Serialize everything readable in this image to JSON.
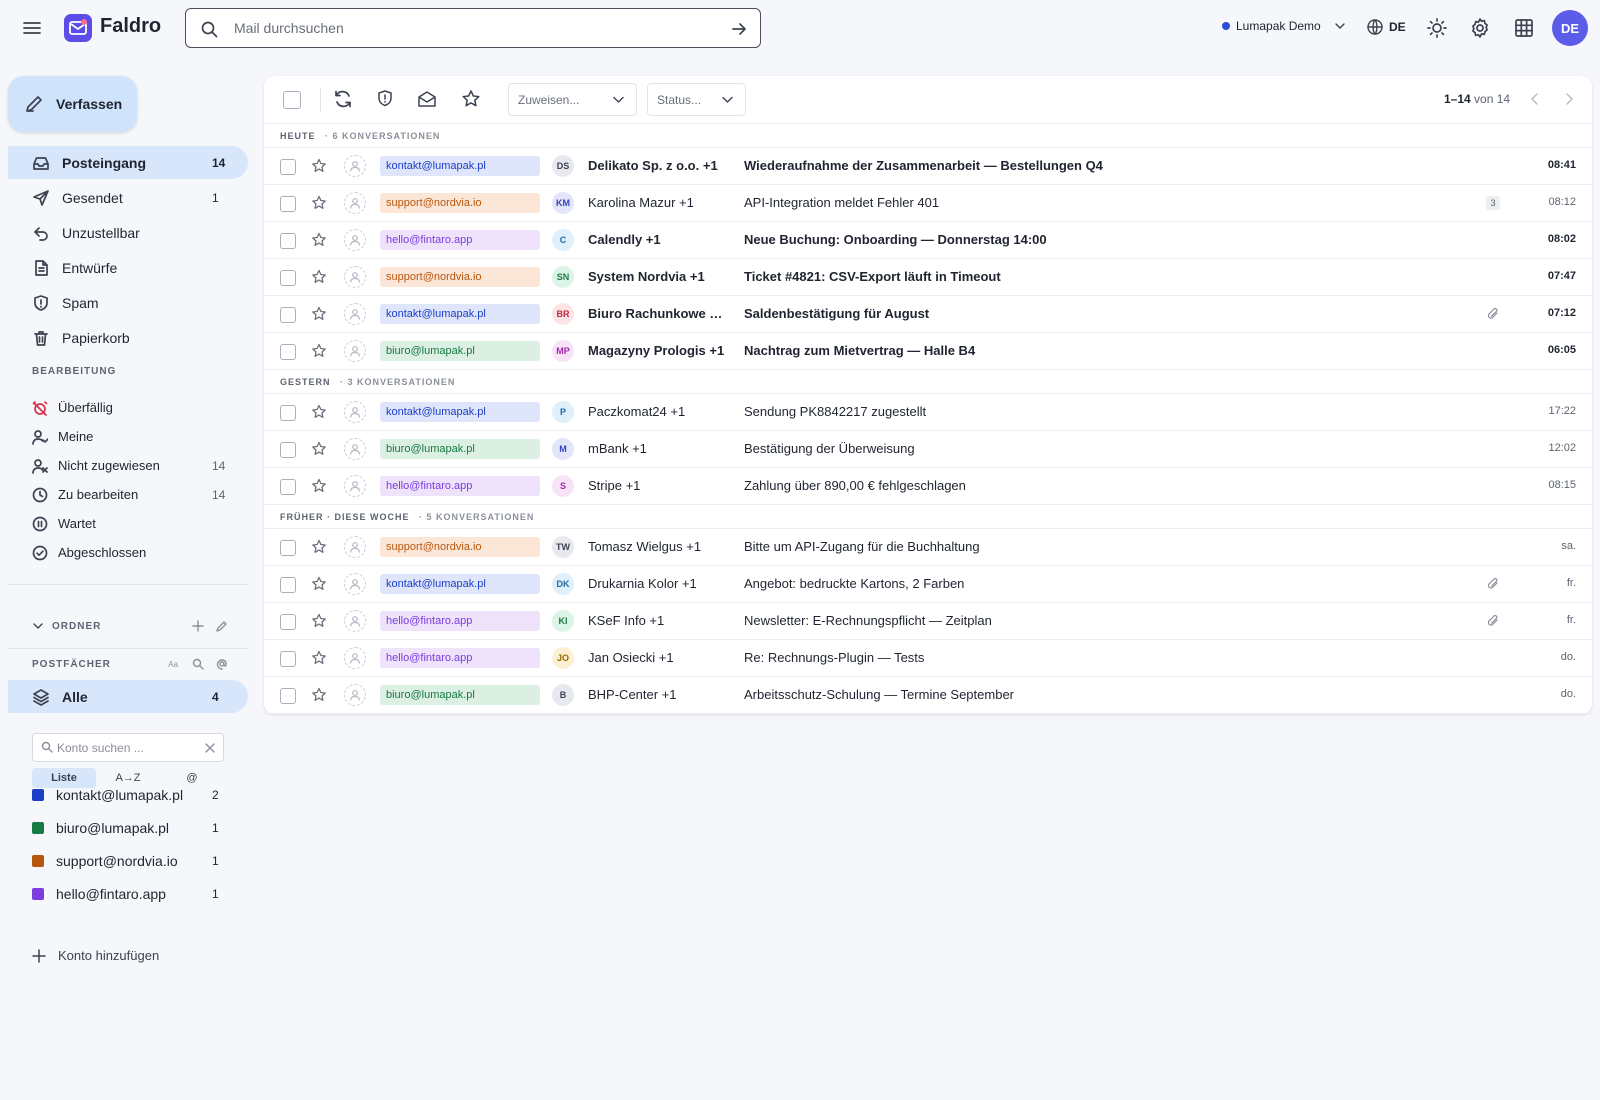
{
  "app": {
    "name": "Faldro"
  },
  "search": {
    "placeholder": "Mail durchsuchen"
  },
  "topbar": {
    "account": "Lumapak Demo",
    "lang": "DE",
    "user_initials": "DE"
  },
  "sidebar": {
    "compose": "Verfassen",
    "folders": [
      {
        "label": "Posteingang",
        "count": "14",
        "icon": "inbox-icon"
      },
      {
        "label": "Gesendet",
        "count": "1",
        "icon": "send-icon"
      },
      {
        "label": "Unzustellbar",
        "count": "",
        "icon": "bounce-icon"
      },
      {
        "label": "Entwürfe",
        "count": "",
        "icon": "draft-icon"
      },
      {
        "label": "Spam",
        "count": "",
        "icon": "spam-shield-icon"
      },
      {
        "label": "Papierkorb",
        "count": "",
        "icon": "trash-icon"
      }
    ],
    "workflow_title": "BEARBEITUNG",
    "workflow": [
      {
        "label": "Überfällig",
        "count": "",
        "icon": "alarm-off-icon"
      },
      {
        "label": "Meine",
        "count": "",
        "icon": "user-check-icon"
      },
      {
        "label": "Nicht zugewiesen",
        "count": "14",
        "icon": "user-x-icon"
      },
      {
        "label": "Zu bearbeiten",
        "count": "14",
        "icon": "clock-icon"
      },
      {
        "label": "Wartet",
        "count": "",
        "icon": "pause-icon"
      },
      {
        "label": "Abgeschlossen",
        "count": "",
        "icon": "check-circle-icon"
      }
    ],
    "ordner_title": "ORDNER",
    "postfaecher_title": "POSTFÄCHER",
    "all": {
      "label": "Alle",
      "count": "4"
    },
    "account_search_placeholder": "Konto suchen ...",
    "view_toggle": [
      "Liste",
      "A→Z",
      "@"
    ],
    "accounts": [
      {
        "label": "kontakt@lumapak.pl",
        "count": "2",
        "color": "#1d3fc6"
      },
      {
        "label": "biuro@lumapak.pl",
        "count": "1",
        "color": "#177a43"
      },
      {
        "label": "support@nordvia.io",
        "count": "1",
        "color": "#b8560e"
      },
      {
        "label": "hello@fintaro.app",
        "count": "1",
        "color": "#7b3ce0"
      }
    ],
    "add_account": "Konto hinzufügen"
  },
  "toolbar": {
    "assign_placeholder": "Zuweisen...",
    "status_placeholder": "Status...",
    "pager_range": "1–14",
    "pager_total": "von 14"
  },
  "groups": [
    {
      "title": "HEUTE",
      "count": "6 KONVERSATIONEN"
    },
    {
      "title": "GESTERN",
      "count": "3 KONVERSATIONEN"
    },
    {
      "title": "FRÜHER · DIESE WOCHE",
      "count": "5 KONVERSATIONEN"
    }
  ],
  "mailbox_colors": {
    "kontakt@lumapak.pl": {
      "bg": "#dfe5fb",
      "fg": "#1d3fc6"
    },
    "support@nordvia.io": {
      "bg": "#fbe6d7",
      "fg": "#b8560e"
    },
    "hello@fintaro.app": {
      "bg": "#efe3fc",
      "fg": "#7b3ce0"
    },
    "biuro@lumapak.pl": {
      "bg": "#dcefe3",
      "fg": "#177a43"
    }
  },
  "emails": [
    {
      "mailbox": "kontakt@lumapak.pl",
      "initials": "DS",
      "sender": "Delikato Sp. z o.o. +1",
      "subject": "Wiederaufnahme der Zusammenarbeit — Bestellungen Q4",
      "time": "08:41",
      "unread": true,
      "thread": "",
      "attachment": false,
      "av_bg": "#e7e9ee",
      "av_fg": "#3c4250"
    },
    {
      "mailbox": "support@nordvia.io",
      "initials": "KM",
      "sender": "Karolina Mazur +1",
      "subject": "API-Integration meldet Fehler 401",
      "time": "08:12",
      "unread": false,
      "thread": "3",
      "attachment": false,
      "av_bg": "#e3e6fb",
      "av_fg": "#3a43b8"
    },
    {
      "mailbox": "hello@fintaro.app",
      "initials": "C",
      "sender": "Calendly +1",
      "subject": "Neue Buchung: Onboarding — Donnerstag 14:00",
      "time": "08:02",
      "unread": true,
      "thread": "",
      "attachment": false,
      "av_bg": "#dff0fb",
      "av_fg": "#1f6aa6"
    },
    {
      "mailbox": "support@nordvia.io",
      "initials": "SN",
      "sender": "System Nordvia +1",
      "subject": "Ticket #4821: CSV-Export läuft in Timeout",
      "time": "07:47",
      "unread": true,
      "thread": "",
      "attachment": false,
      "av_bg": "#dcf4e5",
      "av_fg": "#1e7a47"
    },
    {
      "mailbox": "kontakt@lumapak.pl",
      "initials": "BR",
      "sender": "Biuro Rachunkowe Sal...",
      "subject": "Saldenbestätigung für August",
      "time": "07:12",
      "unread": true,
      "thread": "",
      "attachment": true,
      "av_bg": "#fce3e6",
      "av_fg": "#b82c3e"
    },
    {
      "mailbox": "biuro@lumapak.pl",
      "initials": "MP",
      "sender": "Magazyny Prologis +1",
      "subject": "Nachtrag zum Mietvertrag — Halle B4",
      "time": "06:05",
      "unread": true,
      "thread": "",
      "attachment": false,
      "av_bg": "#f7e3f8",
      "av_fg": "#a02aa8"
    },
    {
      "mailbox": "kontakt@lumapak.pl",
      "initials": "P",
      "sender": "Paczkomat24 +1",
      "subject": "Sendung PK8842217 zugestellt",
      "time": "17:22",
      "unread": false,
      "thread": "",
      "attachment": false,
      "av_bg": "#dff0fb",
      "av_fg": "#1f6aa6"
    },
    {
      "mailbox": "biuro@lumapak.pl",
      "initials": "M",
      "sender": "mBank +1",
      "subject": "Bestätigung der Überweisung",
      "time": "12:02",
      "unread": false,
      "thread": "",
      "attachment": false,
      "av_bg": "#e3e6fb",
      "av_fg": "#3a43b8"
    },
    {
      "mailbox": "hello@fintaro.app",
      "initials": "S",
      "sender": "Stripe +1",
      "subject": "Zahlung über 890,00 € fehlgeschlagen",
      "time": "08:15",
      "unread": false,
      "thread": "",
      "attachment": false,
      "av_bg": "#f7e3f8",
      "av_fg": "#a02aa8"
    },
    {
      "mailbox": "support@nordvia.io",
      "initials": "TW",
      "sender": "Tomasz Wielgus +1",
      "subject": "Bitte um API-Zugang für die Buchhaltung",
      "time": "sa.",
      "unread": false,
      "thread": "",
      "attachment": false,
      "av_bg": "#e7e9ee",
      "av_fg": "#3c4250"
    },
    {
      "mailbox": "kontakt@lumapak.pl",
      "initials": "DK",
      "sender": "Drukarnia Kolor +1",
      "subject": "Angebot: bedruckte Kartons, 2 Farben",
      "time": "fr.",
      "unread": false,
      "thread": "",
      "attachment": true,
      "av_bg": "#dff0fb",
      "av_fg": "#1f6aa6"
    },
    {
      "mailbox": "hello@fintaro.app",
      "initials": "KI",
      "sender": "KSeF Info +1",
      "subject": "Newsletter: E-Rechnungspflicht — Zeitplan",
      "time": "fr.",
      "unread": false,
      "thread": "",
      "attachment": true,
      "av_bg": "#dcf4e5",
      "av_fg": "#1e7a47"
    },
    {
      "mailbox": "hello@fintaro.app",
      "initials": "JO",
      "sender": "Jan Osiecki +1",
      "subject": "Re: Rechnungs-Plugin — Tests",
      "time": "do.",
      "unread": false,
      "thread": "",
      "attachment": false,
      "av_bg": "#fcf0d2",
      "av_fg": "#9a6a00"
    },
    {
      "mailbox": "biuro@lumapak.pl",
      "initials": "B",
      "sender": "BHP-Center +1",
      "subject": "Arbeitsschutz-Schulung — Termine September",
      "time": "do.",
      "unread": false,
      "thread": "",
      "attachment": false,
      "av_bg": "#e7e9ee",
      "av_fg": "#3c4250"
    }
  ]
}
